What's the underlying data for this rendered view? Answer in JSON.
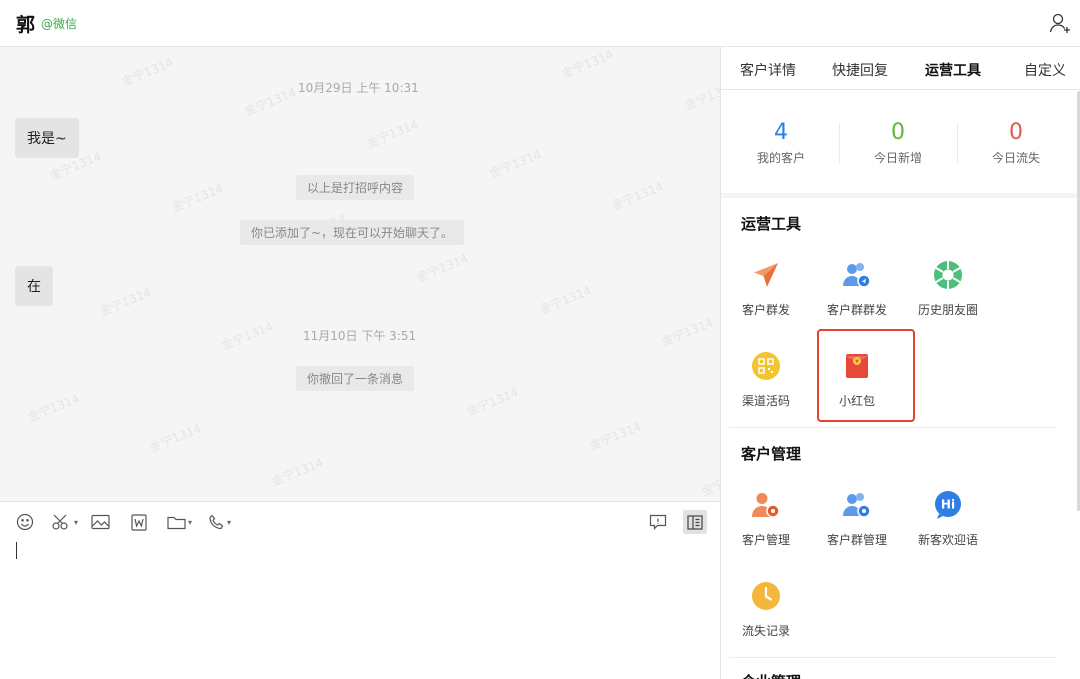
{
  "header": {
    "contact_name": "郭",
    "contact_source": "@微信"
  },
  "chat": {
    "watermark": "金宁1314",
    "messages": [
      {
        "kind": "time",
        "text": "10月29日 上午 10:31"
      },
      {
        "kind": "bubble",
        "text": "我是~"
      },
      {
        "kind": "system",
        "text": "以上是打招呼内容"
      },
      {
        "kind": "system",
        "text": "你已添加了~，现在可以开始聊天了。"
      },
      {
        "kind": "bubble",
        "text": "在"
      },
      {
        "kind": "time",
        "text": "11月10日 下午 3:51"
      },
      {
        "kind": "system",
        "text": "你撤回了一条消息"
      }
    ]
  },
  "toolbar": {
    "tools": [
      "emoji-icon",
      "scissors-icon",
      "image-icon",
      "word-file-icon",
      "folder-icon",
      "phone-icon",
      "chat-feedback-icon",
      "side-panel-toggle-icon"
    ]
  },
  "right_panel": {
    "tabs": [
      {
        "label": "客户详情",
        "active": false
      },
      {
        "label": "快捷回复",
        "active": false
      },
      {
        "label": "运营工具",
        "active": true
      },
      {
        "label": "自定义",
        "active": false
      }
    ],
    "stats": [
      {
        "value": "4",
        "label": "我的客户",
        "color": "#2f7ee6"
      },
      {
        "value": "0",
        "label": "今日新增",
        "color": "#5cb83c"
      },
      {
        "value": "0",
        "label": "今日流失",
        "color": "#e05a50"
      }
    ],
    "sections": [
      {
        "title": "运营工具",
        "items": [
          {
            "label": "客户群发",
            "icon": "paper-plane-icon"
          },
          {
            "label": "客户群群发",
            "icon": "group-send-icon"
          },
          {
            "label": "历史朋友圈",
            "icon": "moments-shutter-icon"
          },
          {
            "label": "渠道活码",
            "icon": "qrcode-icon"
          },
          {
            "label": "小红包",
            "icon": "red-packet-icon",
            "highlighted": true
          }
        ]
      },
      {
        "title": "客户管理",
        "items": [
          {
            "label": "客户管理",
            "icon": "user-gear-icon"
          },
          {
            "label": "客户群管理",
            "icon": "group-gear-icon"
          },
          {
            "label": "新客欢迎语",
            "icon": "hi-bubble-icon"
          },
          {
            "label": "流失记录",
            "icon": "clock-icon"
          }
        ]
      },
      {
        "title": "企业管理"
      }
    ],
    "colors": {
      "highlight": "#e0442f",
      "wechat_green": "#3aa94a"
    }
  }
}
